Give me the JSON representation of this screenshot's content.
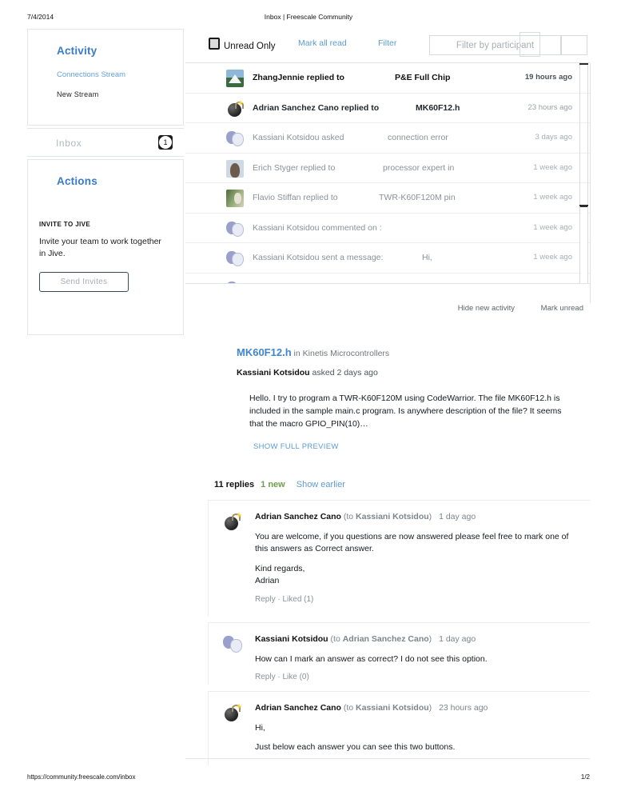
{
  "print": {
    "date": "7/4/2014",
    "title": "Inbox | Freescale Community",
    "url": "https://community.freescale.com/inbox",
    "page": "1/2"
  },
  "sidebar": {
    "activity_heading": "Activity",
    "connections_stream": "Connections Stream",
    "new_stream": "New Stream",
    "inbox_label": "Inbox",
    "inbox_badge": "1",
    "actions_heading": "Actions",
    "invite_kicker": "INVITE TO JIVE",
    "invite_text": "Invite your team to work together in Jive.",
    "send_invites_label": "Send Invites"
  },
  "toolbar": {
    "unread_only": "Unread Only",
    "mark_all_read": "Mark all read",
    "filter": "Filter",
    "participant_placeholder": "Filter by participant",
    "participant_value": ""
  },
  "messages": [
    {
      "avatar": "mountain-avatar",
      "actor": "ZhangJennie replied to",
      "subject": "P&E Full Chip",
      "time": "19 hours ago",
      "state": "unread"
    },
    {
      "avatar": "bomb-avatar",
      "actor": "Adrian Sanchez Cano replied to",
      "subject": "MK60F12.h",
      "time": "23 hours ago",
      "state": "semi"
    },
    {
      "avatar": "masks-avatar",
      "actor": "Kassiani Kotsidou asked",
      "subject": "connection error",
      "time": "3 days ago",
      "state": "read"
    },
    {
      "avatar": "person-avatar",
      "actor": "Erich Styger replied to",
      "subject": "processor expert  in",
      "time": "1 week ago",
      "state": "read"
    },
    {
      "avatar": "outdoor-avatar",
      "actor": "Flavio Stiffan replied to",
      "subject": "TWR-K60F120M pin",
      "time": "1 week ago",
      "state": "read"
    },
    {
      "avatar": "masks-avatar",
      "actor": "Kassiani Kotsidou commented on :",
      "subject": "",
      "time": "1 week ago",
      "state": "read"
    },
    {
      "avatar": "masks-avatar",
      "actor": "Kassiani Kotsidou sent a message:",
      "subject": "Hi,",
      "time": "1 week ago",
      "state": "read"
    }
  ],
  "detail": {
    "hide_new_activity": "Hide new activity",
    "mark_unread": "Mark unread",
    "thread_title": "MK60F12.h",
    "thread_place": " in Kinetis Microcontrollers",
    "author": "Kassiani Kotsidou",
    "author_action": " asked 2 days ago",
    "body": "Hello.   I try to program a TWR-K60F120M using CodeWarrior. The file MK60F12.h is included in the sample main.c program. Is anywhere description of the file? It seems that the macro GPIO_PIN(10)…",
    "show_full_preview": "SHOW FULL PREVIEW",
    "replies_count": "11 replies",
    "replies_new": "1 new",
    "show_earlier": "Show earlier"
  },
  "replies": [
    {
      "avatar": "bomb-avatar",
      "author": "Adrian Sanchez Cano",
      "to": "(to Kassiani Kotsidou)",
      "to_name": "Kassiani Kotsidou",
      "time": "1 day ago",
      "body": "You are welcome, if you questions are now answered please feel free to mark one of this answers as Correct answer.",
      "signoff": "Kind regards,\nAdrian",
      "reply_label": "Reply",
      "like_label": "Liked (1)"
    },
    {
      "avatar": "masks-avatar",
      "author": "Kassiani Kotsidou",
      "to": "(to Adrian Sanchez Cano)",
      "to_name": "Adrian Sanchez Cano",
      "time": "1 day ago",
      "body": "How can I mark an answer as correct? I do not see this option.",
      "signoff": "",
      "reply_label": "Reply",
      "like_label": "Like (0)"
    },
    {
      "avatar": "bomb-avatar",
      "author": "Adrian Sanchez Cano",
      "to": "(to Kassiani Kotsidou)",
      "to_name": "Kassiani Kotsidou",
      "time": "23 hours ago",
      "body": "Hi,",
      "body2": "Just below each answer you can see this two buttons.",
      "signoff": "",
      "reply_label": "",
      "like_label": ""
    }
  ],
  "colors": {
    "link_blue": "#5b9bd5",
    "heading_blue": "#3a7bc8",
    "new_green": "#6e9e4b",
    "muted": "#8a9097"
  }
}
